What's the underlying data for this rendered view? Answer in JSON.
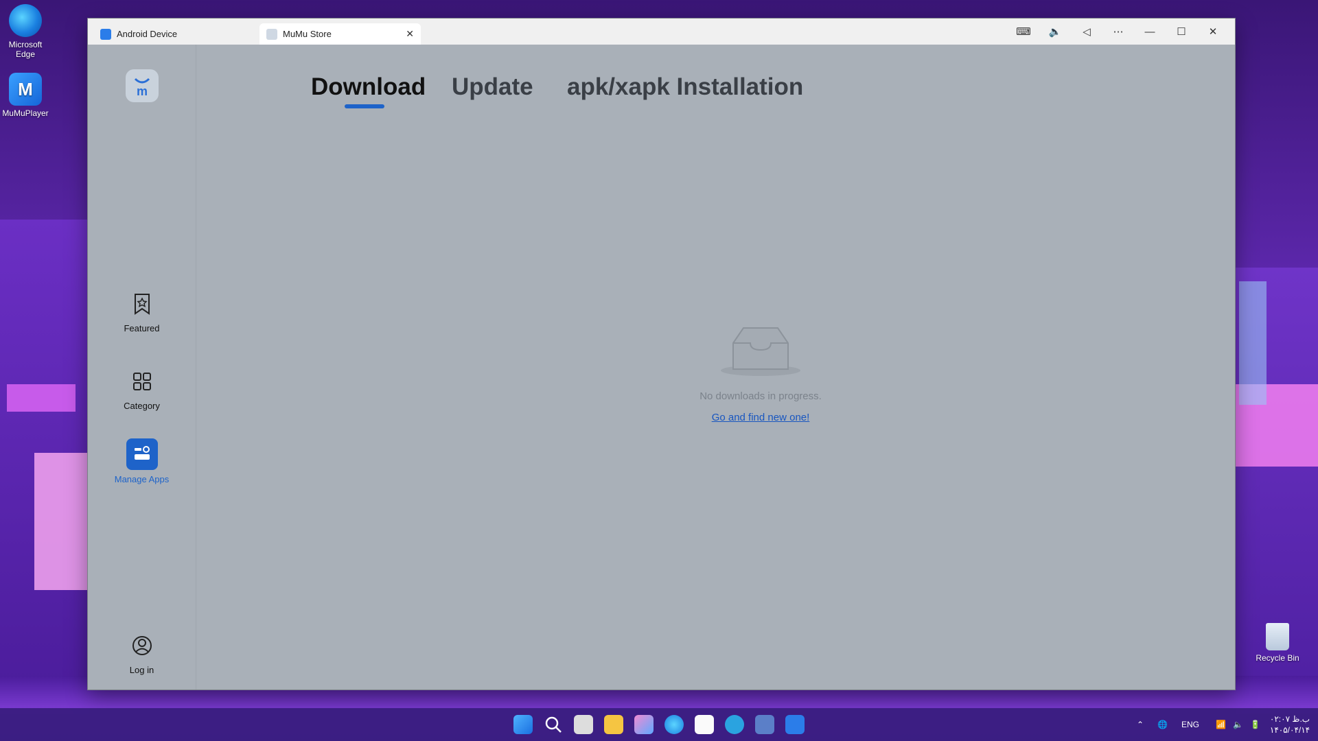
{
  "desktop": {
    "icons": [
      {
        "label": "Microsoft Edge"
      },
      {
        "label": "MuMuPlayer"
      }
    ],
    "recycle_bin": "Recycle Bin"
  },
  "window": {
    "tabs": [
      {
        "label": "Android Device"
      },
      {
        "label": "MuMu Store"
      }
    ],
    "controls": [
      "keyboard-icon",
      "volume-icon",
      "back-icon",
      "more-icon",
      "minimize-icon",
      "maximize-icon",
      "close-icon"
    ]
  },
  "sidebar": {
    "items": [
      {
        "label": "Featured",
        "icon": "bookmark-star-icon"
      },
      {
        "label": "Category",
        "icon": "grid-icon"
      },
      {
        "label": "Manage Apps",
        "icon": "manage-apps-icon",
        "active": true
      },
      {
        "label": "Log in",
        "icon": "user-icon"
      }
    ]
  },
  "main": {
    "tabs": [
      {
        "label": "Download",
        "active": true
      },
      {
        "label": "Update"
      },
      {
        "label": "apk/xapk Installation"
      }
    ],
    "empty_state": {
      "message": "No downloads in progress.",
      "link": "Go and find new one!"
    }
  },
  "taskbar": {
    "language": "ENG",
    "time": "ب.ظ ۰۲:۰۷",
    "date": "۱۴۰۵/۰۴/۱۴"
  },
  "colors": {
    "accent": "#1e63c9",
    "window_bg": "#a9b0b8"
  }
}
